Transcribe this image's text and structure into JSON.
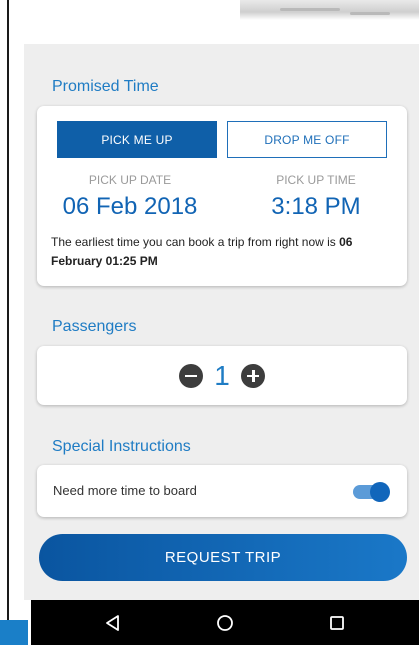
{
  "promised_time": {
    "title": "Promised Time",
    "pick_me_up": "PICK ME UP",
    "drop_me_off": "DROP ME OFF",
    "selected_mode": "pick_me_up",
    "date_label": "PICK UP DATE",
    "date_value": "06 Feb 2018",
    "time_label": "PICK UP TIME",
    "time_value": "3:18 PM",
    "notice_text": "The earliest time you can book a trip from right now is ",
    "notice_bold": "06 February 01:25 PM"
  },
  "passengers": {
    "title": "Passengers",
    "count": "1",
    "decrement_icon": "minus-circle-icon",
    "increment_icon": "plus-circle-icon"
  },
  "special_instructions": {
    "title": "Special Instructions",
    "toggle_label": "Need more time to board",
    "toggle_on": true
  },
  "request_button": "REQUEST TRIP",
  "navigation": {
    "back_icon": "back-triangle-icon",
    "home_icon": "home-circle-icon",
    "recents_icon": "recents-square-icon"
  },
  "colors": {
    "primary": "#0f5fa8",
    "accent_text": "#1f7cc4",
    "background": "#eeeeee",
    "toggle_track": "#5b9bd8",
    "toggle_knob": "#1166bb"
  }
}
